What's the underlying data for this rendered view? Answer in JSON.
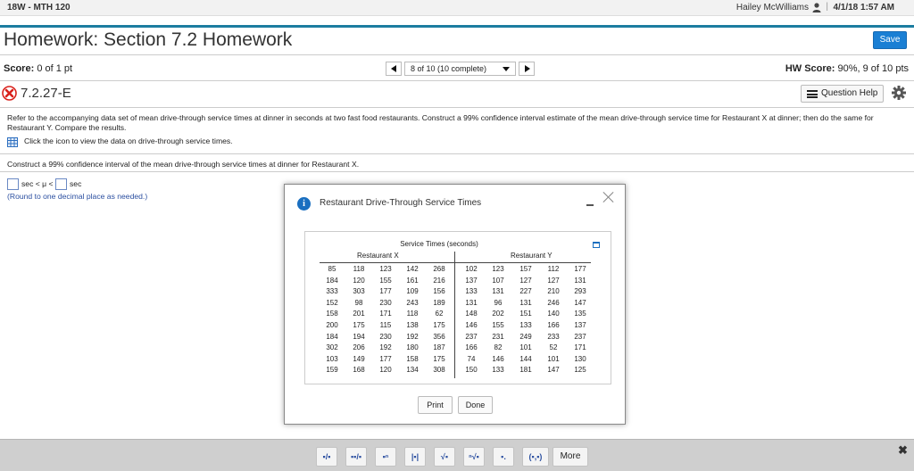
{
  "topbar": {
    "course": "18W - MTH 120",
    "user": "Hailey McWilliams",
    "separator": "|",
    "datetime": "4/1/18 1:57 AM"
  },
  "header": {
    "title": "Homework: Section 7.2 Homework",
    "save_label": "Save"
  },
  "score": {
    "label": "Score:",
    "value": "0 of 1 pt"
  },
  "pager": {
    "current": "8 of 10 (10 complete)"
  },
  "hw_score": {
    "label": "HW Score:",
    "value": "90%, 9 of 10 pts"
  },
  "question": {
    "id": "7.2.27-E",
    "status": "incorrect",
    "help_label": "Question Help",
    "prompt": "Refer to the accompanying data set of mean drive-through service times at dinner in seconds at two fast food restaurants. Construct a 99% confidence interval estimate of the mean drive-through service time for Restaurant X at dinner; then do the same for Restaurant Y. Compare the results.",
    "data_link": "Click the icon to view the data on drive-through service times.",
    "sub_prompt": "Construct a 99% confidence interval of the mean drive-through service times at dinner for Restaurant X.",
    "answer_mid": "sec < μ <",
    "answer_unit": "sec",
    "round_note": "(Round to one decimal place as needed.)"
  },
  "modal": {
    "title": "Restaurant Drive-Through Service Times",
    "table_title": "Service Times (seconds)",
    "group_x": "Restaurant X",
    "group_y": "Restaurant Y",
    "rows": [
      [
        "85",
        "118",
        "123",
        "142",
        "268",
        "102",
        "123",
        "157",
        "112",
        "177"
      ],
      [
        "184",
        "120",
        "155",
        "161",
        "216",
        "137",
        "107",
        "127",
        "127",
        "131"
      ],
      [
        "333",
        "303",
        "177",
        "109",
        "156",
        "133",
        "131",
        "227",
        "210",
        "293"
      ],
      [
        "152",
        "98",
        "230",
        "243",
        "189",
        "131",
        "96",
        "131",
        "246",
        "147"
      ],
      [
        "158",
        "201",
        "171",
        "118",
        "62",
        "148",
        "202",
        "151",
        "140",
        "135"
      ],
      [
        "200",
        "175",
        "115",
        "138",
        "175",
        "146",
        "155",
        "133",
        "166",
        "137"
      ],
      [
        "184",
        "194",
        "230",
        "192",
        "356",
        "237",
        "231",
        "249",
        "233",
        "237"
      ],
      [
        "302",
        "206",
        "192",
        "180",
        "187",
        "166",
        "82",
        "101",
        "52",
        "171"
      ],
      [
        "103",
        "149",
        "177",
        "158",
        "175",
        "74",
        "146",
        "144",
        "101",
        "130"
      ],
      [
        "159",
        "168",
        "120",
        "134",
        "308",
        "150",
        "133",
        "181",
        "147",
        "125"
      ]
    ],
    "print_label": "Print",
    "done_label": "Done"
  },
  "toolbar": {
    "tools": [
      "fraction",
      "mixed-number",
      "exponent",
      "absolute-value",
      "square-root",
      "nth-root",
      "decimal",
      "interval"
    ],
    "tool_glyphs": [
      "▪/▪",
      "▪▪/▪",
      "▪ⁿ",
      "|▪|",
      "√▪",
      "ⁿ√▪",
      "▪.",
      "(▪,▪)"
    ],
    "more_label": "More",
    "close_glyph": "✖"
  },
  "colors": {
    "accent": "#1c7da0",
    "save_button": "#1a7fd4",
    "error": "#d9211b",
    "link_blue": "#2b4fa0"
  }
}
